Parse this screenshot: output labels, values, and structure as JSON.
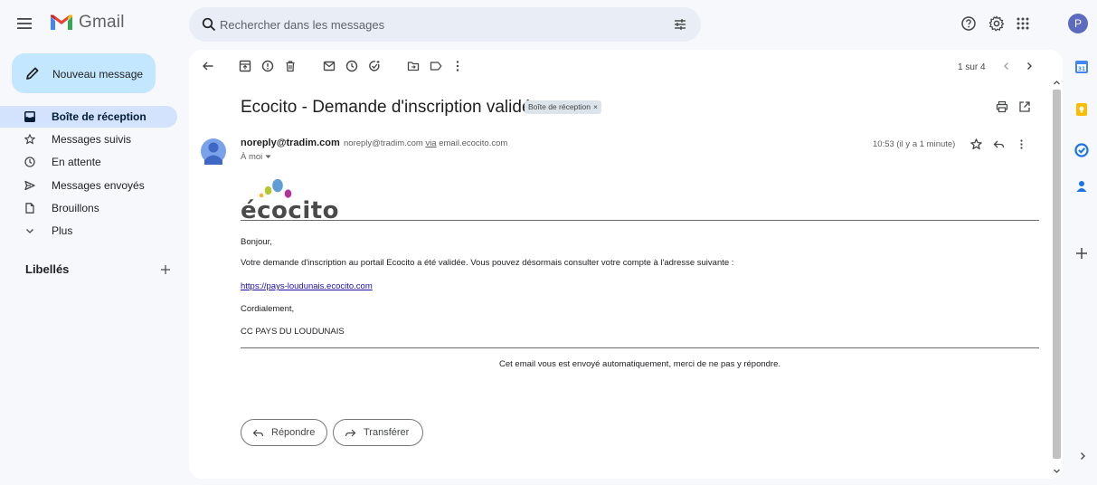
{
  "app": {
    "name": "Gmail",
    "avatar_letter": "P"
  },
  "search": {
    "placeholder": "Rechercher dans les messages"
  },
  "sidebar": {
    "compose_label": "Nouveau message",
    "items": [
      {
        "label": "Boîte de réception",
        "icon": "inbox-icon",
        "active": true
      },
      {
        "label": "Messages suivis",
        "icon": "star-icon"
      },
      {
        "label": "En attente",
        "icon": "clock-icon"
      },
      {
        "label": "Messages envoyés",
        "icon": "send-icon"
      },
      {
        "label": "Brouillons",
        "icon": "draft-icon"
      },
      {
        "label": "Plus",
        "icon": "chevron-down-icon"
      }
    ],
    "labels_title": "Libellés"
  },
  "toolbar": {
    "pager": "1 sur 4"
  },
  "email": {
    "subject": "Ecocito - Demande d'inscription validée",
    "label_chip": "Boîte de réception",
    "label_chip_close": "×",
    "sender_name": "noreply@tradim.com",
    "sender_email": "noreply@tradim.com",
    "via_label": "via",
    "via_domain": "email.ecocito.com",
    "recipient": "À moi",
    "timestamp": "10:53 (il y a 1 minute)",
    "logo_text": "écocito",
    "greeting": "Bonjour,",
    "message": "Votre demande d'inscription au portail Ecocito a été validée. Vous pouvez désormais consulter votre compte à l'adresse suivante :",
    "link": "https://pays-loudunais.ecocito.com",
    "closing": "Cordialement,",
    "signature": "CC PAYS DU LOUDUNAIS",
    "footer": "Cet email vous est envoyé automatiquement, merci de ne pas y répondre.",
    "reply_label": "Répondre",
    "forward_label": "Transférer"
  },
  "colors": {
    "accent": "#0b57d0",
    "compose_bg": "#c2e7ff",
    "active_nav_bg": "#d3e3fd",
    "link": "#1a0dab"
  }
}
